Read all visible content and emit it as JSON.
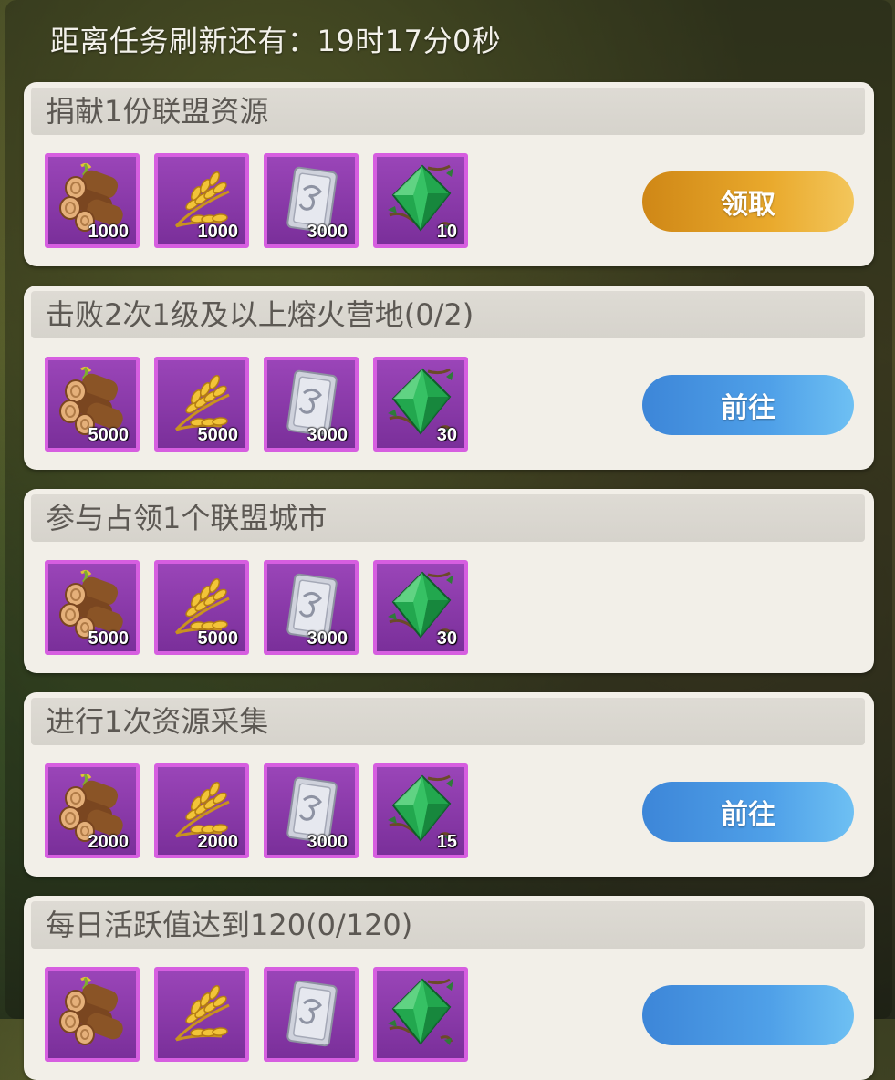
{
  "refresh_timer": "距离任务刷新还有：19时17分0秒",
  "colors": {
    "claim_button": "#e9a92c",
    "go_button": "#4fa0e8",
    "reward_frame": "#d65ee0"
  },
  "tasks": [
    {
      "title": "捐献1份联盟资源",
      "rewards": [
        {
          "icon": "wood-logs-icon",
          "amount": "1000"
        },
        {
          "icon": "wheat-icon",
          "amount": "1000"
        },
        {
          "icon": "silver-card-icon",
          "amount": "3000"
        },
        {
          "icon": "emerald-gem-icon",
          "amount": "10"
        }
      ],
      "button": "领取"
    },
    {
      "title": "击败2次1级及以上熔火营地(0/2)",
      "rewards": [
        {
          "icon": "wood-logs-icon",
          "amount": "5000"
        },
        {
          "icon": "wheat-icon",
          "amount": "5000"
        },
        {
          "icon": "silver-card-icon",
          "amount": "3000"
        },
        {
          "icon": "emerald-gem-icon",
          "amount": "30"
        }
      ],
      "button": "前往"
    },
    {
      "title": "参与占领1个联盟城市",
      "rewards": [
        {
          "icon": "wood-logs-icon",
          "amount": "5000"
        },
        {
          "icon": "wheat-icon",
          "amount": "5000"
        },
        {
          "icon": "silver-card-icon",
          "amount": "3000"
        },
        {
          "icon": "emerald-gem-icon",
          "amount": "30"
        }
      ]
    },
    {
      "title": "进行1次资源采集",
      "rewards": [
        {
          "icon": "wood-logs-icon",
          "amount": "2000"
        },
        {
          "icon": "wheat-icon",
          "amount": "2000"
        },
        {
          "icon": "silver-card-icon",
          "amount": "3000"
        },
        {
          "icon": "emerald-gem-icon",
          "amount": "15"
        }
      ],
      "button": "前往"
    },
    {
      "title": "每日活跃值达到120(0/120)",
      "rewards": [
        {
          "icon": "wood-logs-icon",
          "amount": ""
        },
        {
          "icon": "wheat-icon",
          "amount": ""
        },
        {
          "icon": "silver-card-icon",
          "amount": ""
        },
        {
          "icon": "emerald-gem-icon",
          "amount": ""
        }
      ],
      "button": ""
    }
  ]
}
